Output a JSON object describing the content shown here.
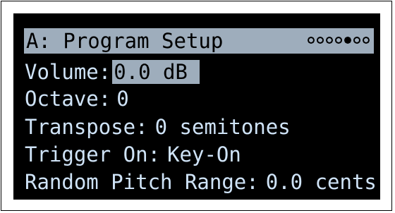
{
  "header": {
    "title": "A: Program Setup",
    "pages": [
      false,
      false,
      false,
      false,
      true,
      false,
      false,
      false
    ],
    "active_page": 5,
    "page_count": 8
  },
  "params": [
    {
      "label": "Volume:",
      "value": "0.0 dB",
      "selected": true
    },
    {
      "label": "Octave:",
      "value": "0"
    },
    {
      "label": "Transpose:",
      "value": "0 semitones"
    },
    {
      "label": "Trigger On:",
      "value": "Key-On"
    },
    {
      "label": "Random Pitch Range:",
      "value": "0.0 cents"
    }
  ],
  "colors": {
    "display_text": "#cfe3f7",
    "display_background": "#000000",
    "highlight": "#cfe3f7"
  }
}
